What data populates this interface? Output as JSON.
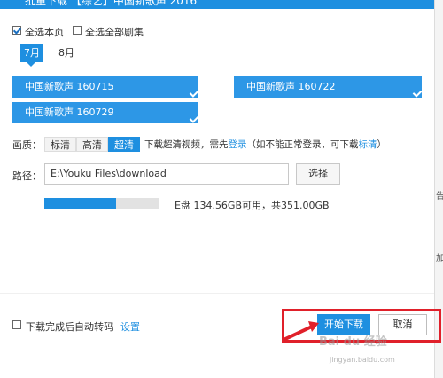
{
  "window": {
    "title": "批量下载 【综艺】中国新歌声 2016"
  },
  "select": {
    "page_label": "全选本页",
    "page_checked": true,
    "all_label": "全选全部剧集",
    "all_checked": false
  },
  "months": [
    {
      "label": "7月",
      "selected": true
    },
    {
      "label": "8月",
      "selected": false
    }
  ],
  "episodes": [
    {
      "label": "中国新歌声 160715",
      "selected": true
    },
    {
      "label": "中国新歌声 160722",
      "selected": true
    },
    {
      "label": "中国新歌声 160729",
      "selected": true
    }
  ],
  "quality": {
    "label": "画质：",
    "options": [
      {
        "label": "标清",
        "selected": false
      },
      {
        "label": "高清",
        "selected": false
      },
      {
        "label": "超清",
        "selected": true
      }
    ],
    "hint_prefix": "下载超清视频，需先",
    "hint_login": "登录",
    "hint_middle": "（如不能正常登录，可下载",
    "hint_sd": "标清",
    "hint_suffix": "）"
  },
  "path": {
    "label": "路径：",
    "value": "E:\\Youku Files\\download",
    "browse_label": "选择"
  },
  "disk": {
    "usage_fraction": 0.62,
    "text": "E盘 134.56GB可用，共351.00GB"
  },
  "footer": {
    "auto_transcode_label": "下载完成后自动转码",
    "auto_transcode_checked": false,
    "settings_label": "设置",
    "start_label": "开始下载",
    "cancel_label": "取消"
  },
  "background_page": {
    "chars": [
      "告",
      "加"
    ]
  },
  "watermark": {
    "brand": "Bai du 经验",
    "url": "jingyan.baidu.com"
  },
  "colors": {
    "accent": "#1e8fe0",
    "highlight": "#e0202a"
  }
}
